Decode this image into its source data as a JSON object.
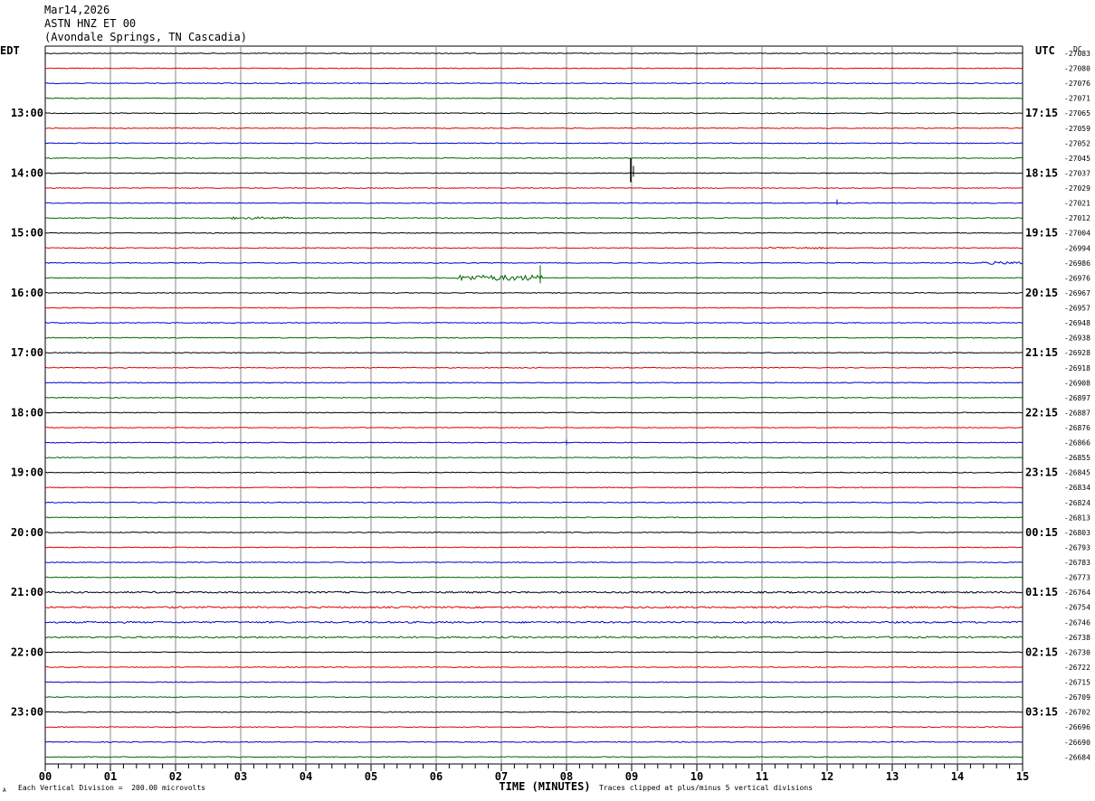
{
  "header": {
    "date": "Mar14,2026",
    "station": "ASTN HNZ ET 00",
    "location": "(Avondale Springs, TN Cascadia)"
  },
  "chart_data": {
    "type": "line",
    "title": "",
    "xlabel": "TIME (MINUTES)",
    "left_timezone": "EDT",
    "right_timezone": "UTC",
    "right_unit": "DC",
    "x_ticks": [
      "00",
      "01",
      "02",
      "03",
      "04",
      "05",
      "06",
      "07",
      "08",
      "09",
      "10",
      "11",
      "12",
      "13",
      "14",
      "15"
    ],
    "xlim": [
      0,
      15
    ],
    "left_hour_labels": [
      "13:00",
      "14:00",
      "15:00",
      "16:00",
      "17:00",
      "18:00",
      "19:00",
      "20:00",
      "21:00",
      "22:00",
      "23:00"
    ],
    "right_hour_labels": [
      "17:15",
      "18:15",
      "19:15",
      "20:15",
      "21:15",
      "22:15",
      "23:15",
      "00:15",
      "01:15",
      "02:15",
      "03:15"
    ],
    "trace_colors": [
      "#000000",
      "#e00000",
      "#0000d0",
      "#006600"
    ],
    "dc_offsets": [
      "-27083",
      "-27080",
      "-27076",
      "-27071",
      "-27065",
      "-27059",
      "-27052",
      "-27045",
      "-27037",
      "-27029",
      "-27021",
      "-27012",
      "-27004",
      "-26994",
      "-26986",
      "-26976",
      "-26967",
      "-26957",
      "-26948",
      "-26938",
      "-26928",
      "-26918",
      "-26908",
      "-26897",
      "-26887",
      "-26876",
      "-26866",
      "-26855",
      "-26845",
      "-26834",
      "-26824",
      "-26813",
      "-26803",
      "-26793",
      "-26783",
      "-26773",
      "-26764",
      "-26754",
      "-26746",
      "-26738",
      "-26730",
      "-26722",
      "-26715",
      "-26709",
      "-26702",
      "-26696",
      "-26690",
      "-26684"
    ],
    "grid": true
  },
  "footer": {
    "scale_note": "Each Vertical Division =  200.00 microvolts",
    "clip_note": "Traces clipped at plus/minus 5 vertical divisions",
    "corner_mark": "A"
  }
}
